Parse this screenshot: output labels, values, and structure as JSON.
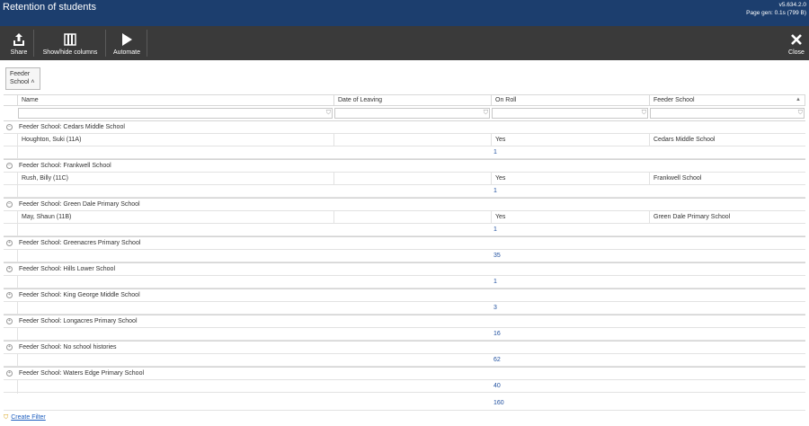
{
  "window": {
    "title": "Retention of students",
    "version": "v5.634.2.0",
    "page_gen": "Page gen: 0.1s (799 B)"
  },
  "toolbar": {
    "share_label": "Share",
    "columns_label": "Show/hide columns",
    "automate_label": "Automate",
    "close_label": "Close"
  },
  "grouping": {
    "chip_label_1": "Feeder",
    "chip_label_2": "School ˄"
  },
  "columns": {
    "name": "Name",
    "date_of_leaving": "Date of Leaving",
    "on_roll": "On Roll",
    "feeder_school": "Feeder School"
  },
  "groups": [
    {
      "label": "Feeder School: Cedars Middle School",
      "expanded": true,
      "rows": [
        {
          "name": "Houghton, Suki (11A)",
          "date": "",
          "on_roll": "Yes",
          "feeder": "Cedars Middle School"
        }
      ],
      "count": "1"
    },
    {
      "label": "Feeder School: Frankwell School",
      "expanded": true,
      "rows": [
        {
          "name": "Rush, Billy (11C)",
          "date": "",
          "on_roll": "Yes",
          "feeder": "Frankwell School"
        }
      ],
      "count": "1"
    },
    {
      "label": "Feeder School: Green Dale Primary School",
      "expanded": true,
      "rows": [
        {
          "name": "May, Shaun (11B)",
          "date": "",
          "on_roll": "Yes",
          "feeder": "Green Dale Primary School"
        }
      ],
      "count": "1"
    },
    {
      "label": "Feeder School: Greenacres Primary School",
      "expanded": false,
      "rows": [],
      "count": "35"
    },
    {
      "label": "Feeder School: Hills Lower School",
      "expanded": false,
      "rows": [],
      "count": "1"
    },
    {
      "label": "Feeder School: King George Middle School",
      "expanded": false,
      "rows": [],
      "count": "3"
    },
    {
      "label": "Feeder School: Longacres Primary School",
      "expanded": false,
      "rows": [],
      "count": "16"
    },
    {
      "label": "Feeder School: No school histories",
      "expanded": false,
      "rows": [],
      "count": "62"
    },
    {
      "label": "Feeder School: Waters Edge Primary School",
      "expanded": false,
      "rows": [],
      "count": "40"
    }
  ],
  "grand_total": "160",
  "footer": {
    "create_filter": "Create Filter"
  },
  "colors": {
    "titlebar": "#1c3e6e",
    "toolbar": "#3a3a3a",
    "link": "#1f5fbf",
    "count": "#1f4f9f"
  },
  "icons": {
    "share": "share-icon",
    "columns": "columns-icon",
    "automate": "play-icon",
    "close": "close-icon",
    "filter": "filter-icon",
    "expand": "expand-icon",
    "collapse": "collapse-icon"
  }
}
